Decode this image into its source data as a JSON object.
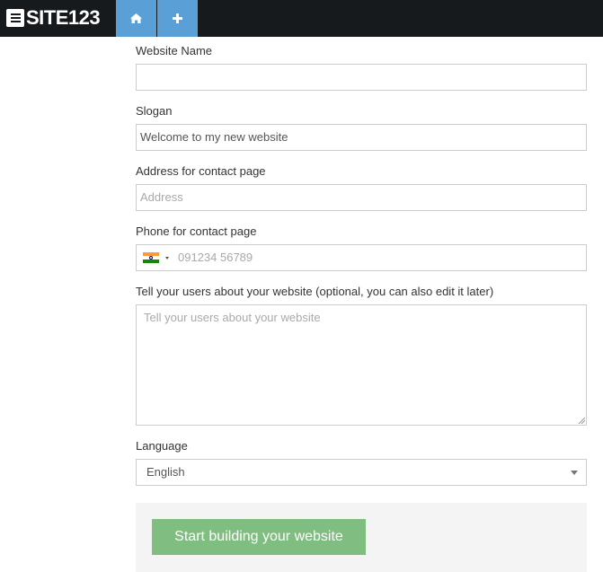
{
  "app": {
    "logo_text": "SITE123"
  },
  "topbar": {
    "home_icon": "home-icon",
    "add_icon": "plus-icon"
  },
  "form": {
    "website_name": {
      "label": "Website Name",
      "value": ""
    },
    "slogan": {
      "label": "Slogan",
      "value": "Welcome to my new website"
    },
    "address": {
      "label": "Address for contact page",
      "placeholder": "Address"
    },
    "phone": {
      "label": "Phone for contact page",
      "placeholder": "091234 56789",
      "flag": "india-flag-icon"
    },
    "description": {
      "label": "Tell your users about your website (optional, you can also edit it later)",
      "placeholder": "Tell your users about your website"
    },
    "language": {
      "label": "Language",
      "selected": "English"
    },
    "submit_label": "Start building your website"
  },
  "colors": {
    "topbar_bg": "#161a1d",
    "topbar_button": "#5aa0d6",
    "submit_button": "#80bd80",
    "footer_panel": "#f4f4f4"
  }
}
